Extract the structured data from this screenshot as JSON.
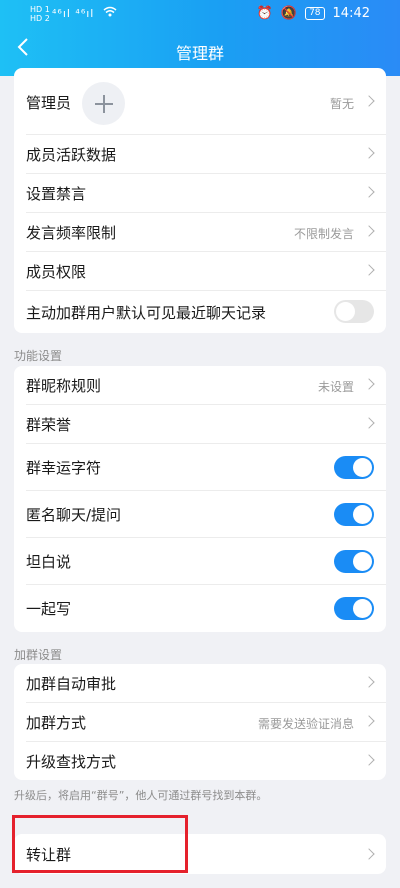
{
  "status_bar": {
    "left_labels": [
      "HD 1",
      "HD 2"
    ],
    "signal": "⁴⁶ıl ⁴⁶ıl",
    "wifi": "wifi-icon",
    "battery": "78",
    "time": "14:42"
  },
  "nav": {
    "back_icon": "back-chevron-icon",
    "title": "管理群"
  },
  "admin_card": {
    "admin_label": "管理员",
    "admin_value": "暂无",
    "rows": [
      {
        "label": "成员活跃数据",
        "value": ""
      },
      {
        "label": "设置禁言",
        "value": ""
      },
      {
        "label": "发言频率限制",
        "value": "不限制发言"
      },
      {
        "label": "成员权限",
        "value": ""
      }
    ],
    "toggle_row": {
      "label": "主动加群用户默认可见最近聊天记录",
      "on": false
    }
  },
  "function_section": {
    "title": "功能设置",
    "rows": [
      {
        "label": "群昵称规则",
        "value": "未设置",
        "type": "link"
      },
      {
        "label": "群荣誉",
        "value": "",
        "type": "link"
      },
      {
        "label": "群幸运字符",
        "type": "toggle",
        "on": true
      },
      {
        "label": "匿名聊天/提问",
        "type": "toggle",
        "on": true
      },
      {
        "label": "坦白说",
        "type": "toggle",
        "on": true
      },
      {
        "label": "一起写",
        "type": "toggle",
        "on": true
      }
    ]
  },
  "join_section": {
    "title": "加群设置",
    "rows": [
      {
        "label": "加群自动审批",
        "value": ""
      },
      {
        "label": "加群方式",
        "value": "需要发送验证消息"
      },
      {
        "label": "升级查找方式",
        "value": ""
      }
    ],
    "hint": "升级后，将启用“群号”，他人可通过群号找到本群。"
  },
  "transfer": {
    "label": "转让群"
  },
  "colors": {
    "header_start": "#1ec0f5",
    "header_end": "#2a8bf6",
    "toggle_on": "#1a8cf5",
    "highlight": "#e5212c"
  }
}
